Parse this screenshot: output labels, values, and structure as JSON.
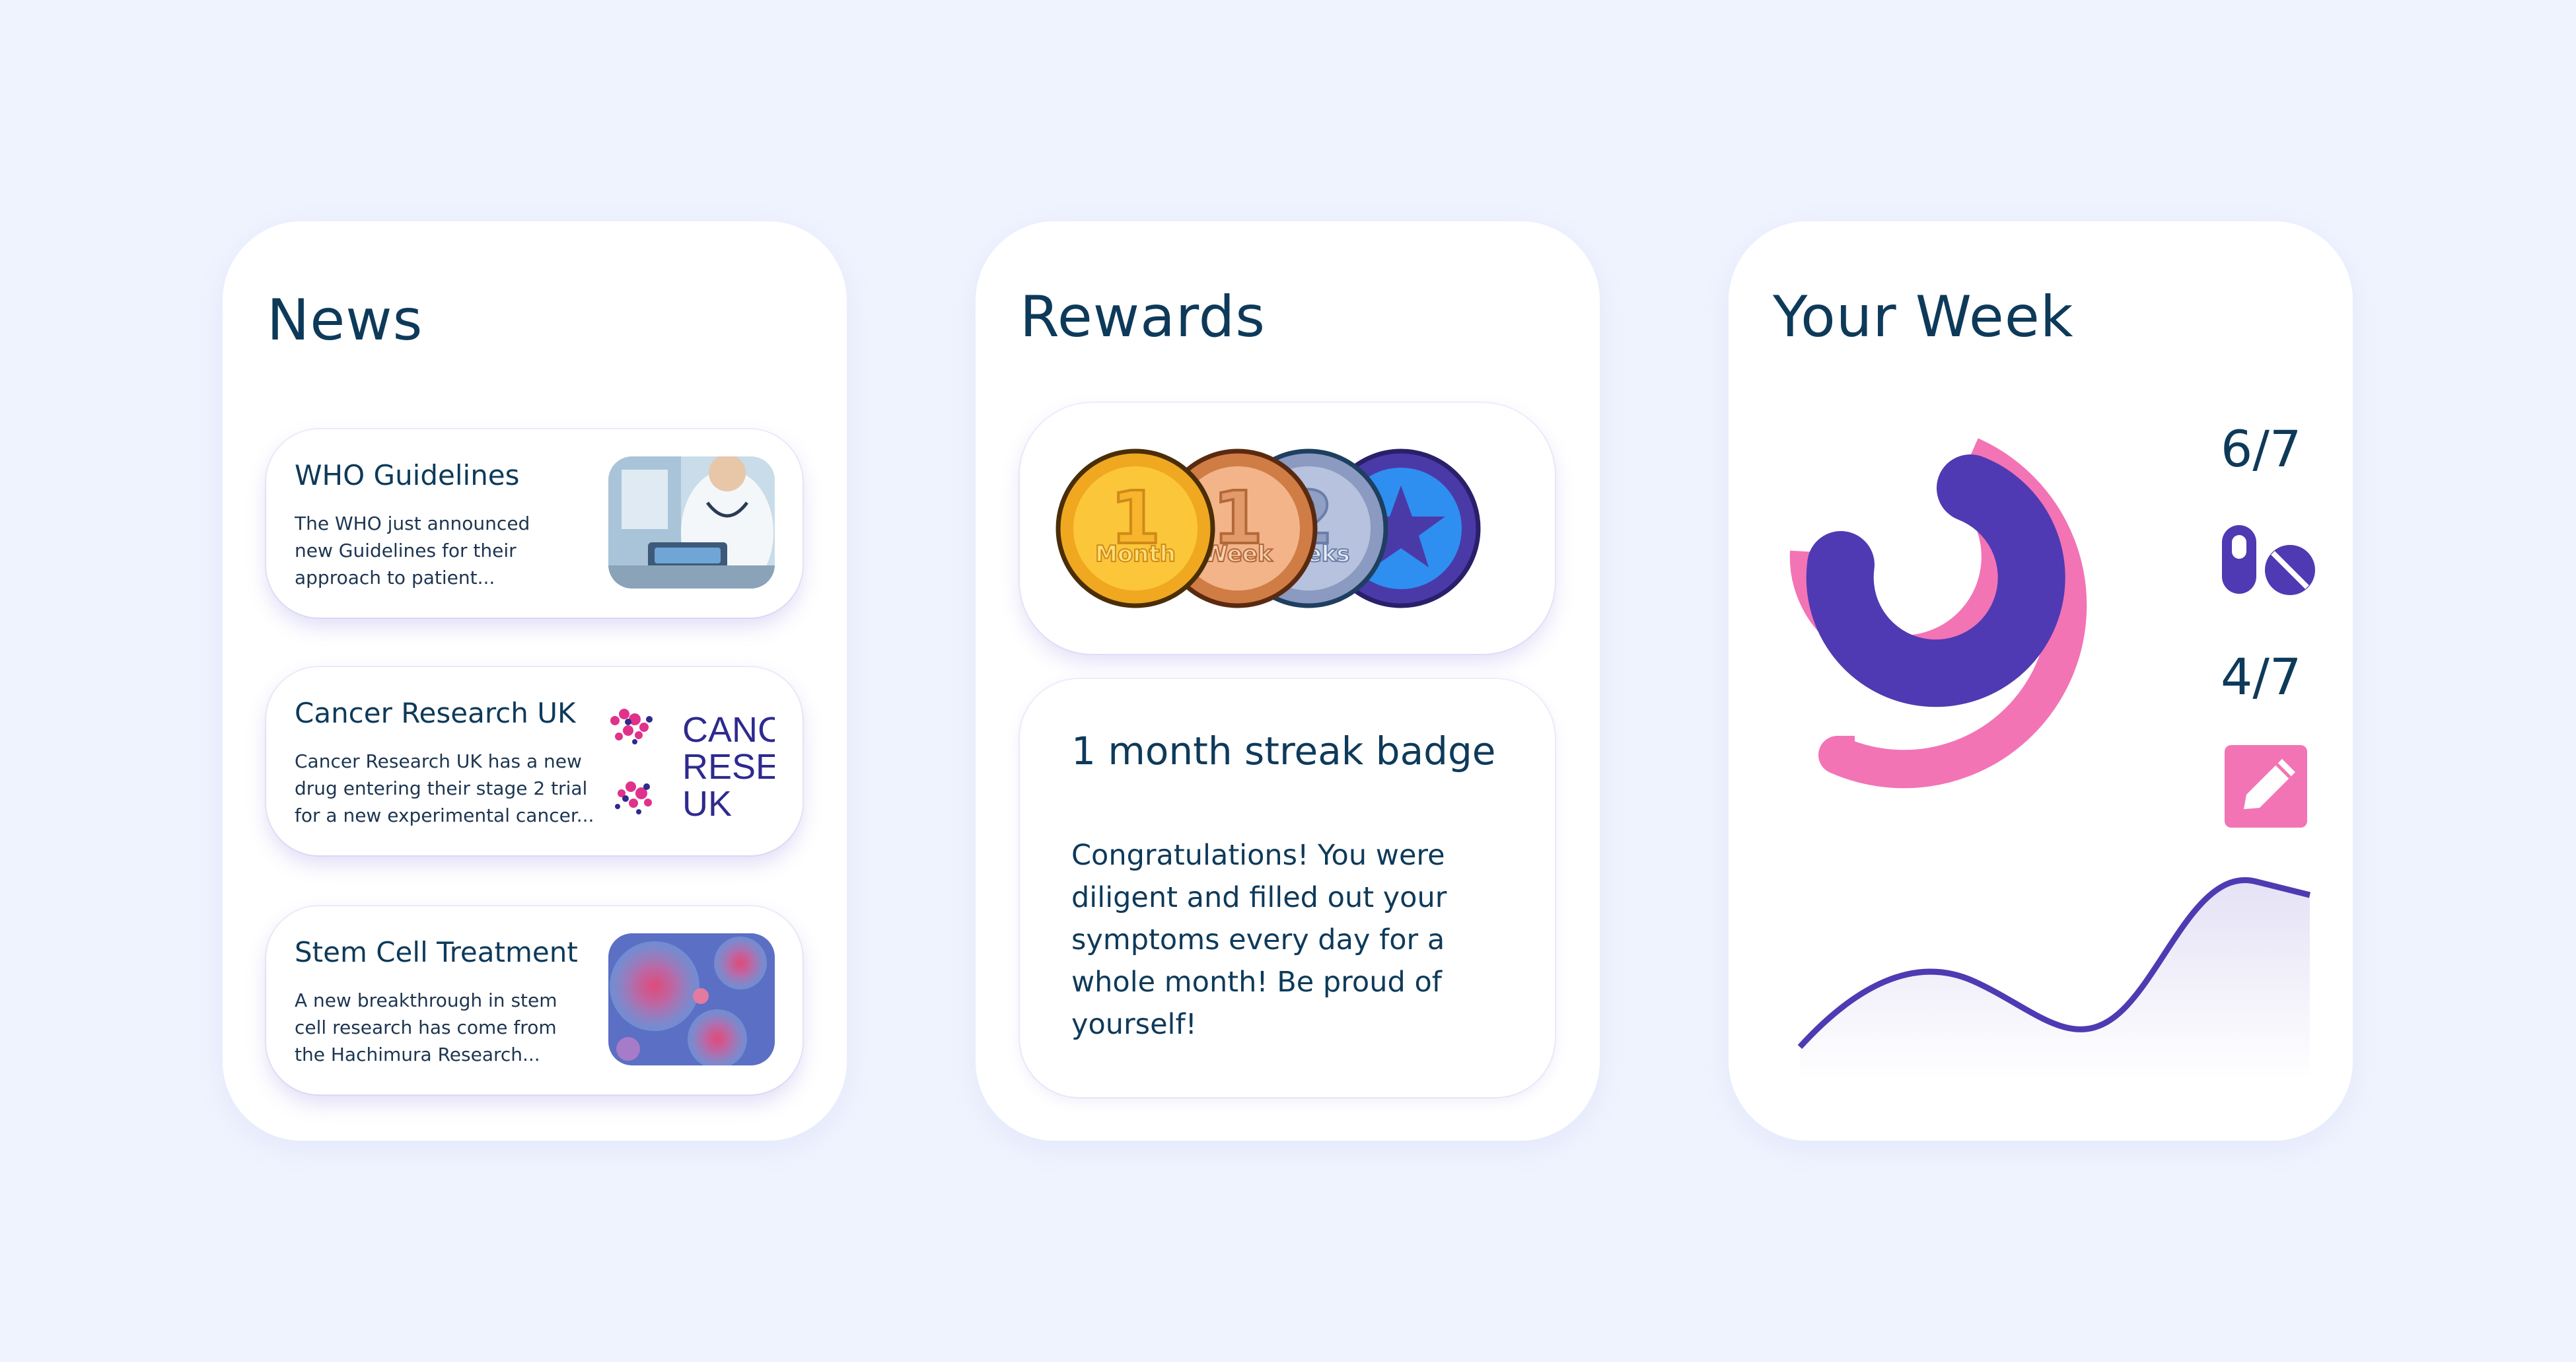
{
  "news": {
    "title": "News",
    "items": [
      {
        "title": "WHO Guidelines",
        "body_lines": [
          "The WHO just announced",
          "new Guidelines for their",
          "approach to patient..."
        ]
      },
      {
        "title": "Cancer Research UK",
        "body_lines": [
          "Cancer Research UK has a new",
          "drug entering their stage 2 trial",
          "for a new experimental cancer..."
        ],
        "logo_lines": [
          "CANC",
          "RESEA",
          "UK"
        ]
      },
      {
        "title": "Stem Cell Treatment",
        "body_lines": [
          "A new breakthrough in stem",
          "cell research has come from",
          "the Hachimura Research..."
        ]
      }
    ]
  },
  "rewards": {
    "title": "Rewards",
    "medals": [
      {
        "num": "1",
        "label": "Month",
        "color": "#f7c12b"
      },
      {
        "num": "1",
        "label": "Week",
        "color": "#e89a62"
      },
      {
        "num": "2",
        "label": "Weeks",
        "color": "#a8b5d4"
      },
      {
        "icon": "star-icon",
        "color": "#3f8ff0"
      }
    ],
    "badge": {
      "title": "1 month streak badge",
      "lines": [
        "Congratulations! You were",
        "diligent and filled out your",
        "symptoms every day for a",
        "whole month! Be proud of",
        "yourself!"
      ]
    }
  },
  "week": {
    "title": "Your Week",
    "stat_top": "6/7",
    "stat_bottom": "4/7",
    "colors": {
      "pink": "#f274b5",
      "purple": "#4f3ab3",
      "dark": "#0e3a5a"
    }
  }
}
